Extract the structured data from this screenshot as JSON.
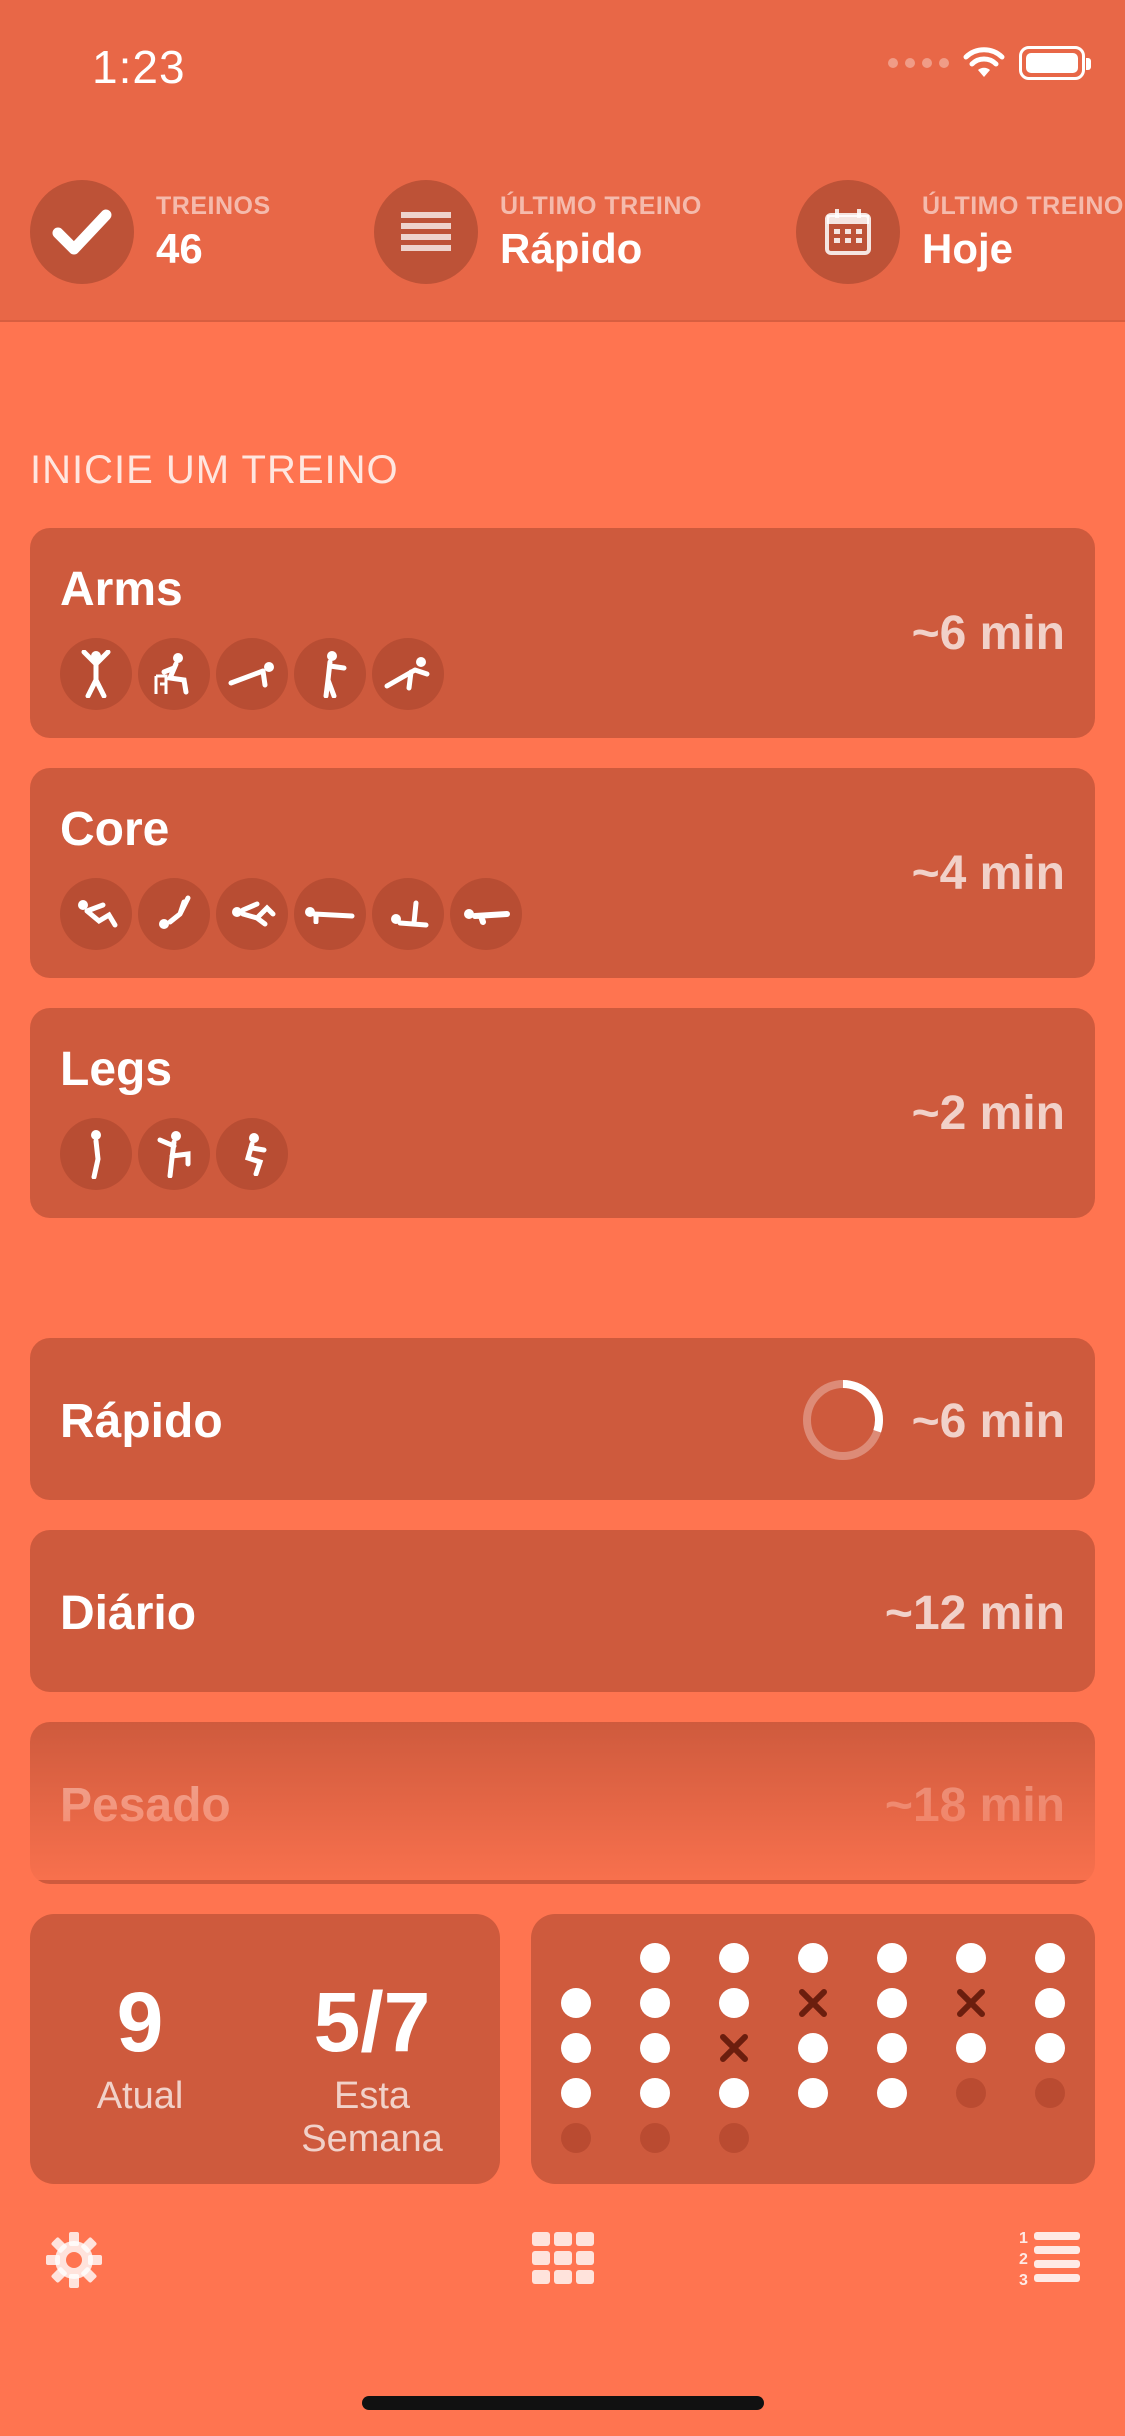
{
  "status_bar": {
    "time": "1:23"
  },
  "header": {
    "stats": [
      {
        "label": "TREINOS",
        "value": "46",
        "icon": "checkmark-icon"
      },
      {
        "label": "ÚLTIMO TREINO",
        "value": "Rápido",
        "icon": "list-icon"
      },
      {
        "label": "ÚLTIMO TREINO",
        "value": "Hoje",
        "icon": "calendar-icon"
      }
    ]
  },
  "section_title": "INICIE UM TREINO",
  "muscle_workouts": [
    {
      "name": "Arms",
      "duration": "~6 min",
      "exercise_icons": [
        "jumping-jack-icon",
        "chair-dip-icon",
        "push-up-icon",
        "wall-push-icon",
        "plank-rotation-icon"
      ]
    },
    {
      "name": "Core",
      "duration": "~4 min",
      "exercise_icons": [
        "crunch-icon",
        "leg-raise-icon",
        "bicycle-crunch-icon",
        "plank-icon",
        "side-plank-icon",
        "superman-icon"
      ]
    },
    {
      "name": "Legs",
      "duration": "~2 min",
      "exercise_icons": [
        "wall-sit-icon",
        "high-knees-icon",
        "squat-icon"
      ]
    }
  ],
  "intensity_workouts": [
    {
      "name": "Rápido",
      "duration": "~6 min",
      "progress": 0.3
    },
    {
      "name": "Diário",
      "duration": "~12 min"
    },
    {
      "name": "Pesado",
      "duration": "~18 min"
    }
  ],
  "streak": {
    "current_value": "9",
    "current_label": "Atual",
    "week_value": "5/7",
    "week_label": "Esta Semana"
  },
  "history_grid": {
    "note": "columns left to right, cells top to bottom; d=done dot, x=missed, f=faint future, e=empty",
    "columns": [
      [
        "e",
        "d",
        "d",
        "d",
        "f"
      ],
      [
        "d",
        "d",
        "d",
        "d",
        "f"
      ],
      [
        "d",
        "d",
        "x",
        "d",
        "f"
      ],
      [
        "d",
        "x",
        "d",
        "d",
        "e"
      ],
      [
        "d",
        "d",
        "d",
        "d",
        "e"
      ],
      [
        "d",
        "x",
        "d",
        "f",
        "e"
      ],
      [
        "d",
        "d",
        "d",
        "f",
        "e"
      ]
    ]
  },
  "tabbar": {
    "left_icon": "gear-icon",
    "center_icon": "grid-icon",
    "right_icon": "numbered-list-icon"
  },
  "colors": {
    "background": "#FF7450",
    "header": "#E86747",
    "card": "#CE5A3D",
    "circle": "#BD5237"
  }
}
